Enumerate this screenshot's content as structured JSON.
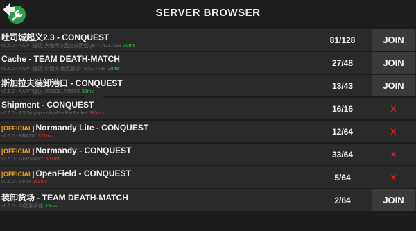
{
  "header": {
    "title": "SERVER BROWSER"
  },
  "colors": {
    "background": "#1c1c1c",
    "row": "#2a2a2a",
    "join_bg": "#3a3a3a",
    "official": "#f0a01e",
    "ping_good": "#3ec24a",
    "ping_bad": "#e02a2a",
    "full_x": "#e02020",
    "back_circle": "#2e9e4a"
  },
  "icons": {
    "back": "back-arrow-wrench-icon"
  },
  "servers": [
    {
      "official": "",
      "name": "吐司城起义2.3 - CONQUEST",
      "sub": "v0.5.0 - AAA中国区-大地阿尔瓦全关闭组QB-714217299",
      "ping": "30ms",
      "ping_status": "good",
      "players": "81/128",
      "action": "JOIN",
      "full": false
    },
    {
      "official": "",
      "name": "Cache - TEAM DEATH-MATCH",
      "sub": "v0.5.0 - AAA中国区-小图洗 地区服群-714217299",
      "ping": "20ms",
      "ping_status": "good",
      "players": "27/48",
      "action": "JOIN",
      "full": false
    },
    {
      "official": "",
      "name": "斯加拉夫装卸港口 - CONQUEST",
      "sub": "v0.5.0 - AAA中国区-2021081445553",
      "ping": "32ms",
      "ping_status": "good",
      "players": "13/43",
      "action": "JOIN",
      "full": false
    },
    {
      "official": "",
      "name": "Shipment - CONQUEST",
      "sub": "v0.5.0 - AS|Singapore|byWealthyBucket",
      "ping": "385ms",
      "ping_status": "bad",
      "players": "16/16",
      "action": "X",
      "full": true
    },
    {
      "official": "[OFFICIAL]",
      "name": "Normandy Lite - CONQUEST",
      "sub": "v0.5.0 - BRAZIL",
      "ping": "371ms",
      "ping_status": "bad",
      "players": "12/64",
      "action": "X",
      "full": true
    },
    {
      "official": "[OFFICIAL]",
      "name": "Normandy - CONQUEST",
      "sub": "v0.5.0 - GERMANY",
      "ping": "381ms",
      "ping_status": "bad",
      "players": "33/64",
      "action": "X",
      "full": true
    },
    {
      "official": "[OFFICIAL]",
      "name": "OpenField - CONQUEST",
      "sub": "v0.5.0 - IRAN",
      "ping": "258ms",
      "ping_status": "bad",
      "players": "5/64",
      "action": "X",
      "full": true
    },
    {
      "official": "",
      "name": "装卸货场 - TEAM DEATH-MATCH",
      "sub": "v0.5.0 - 中国服务器",
      "ping": "13ms",
      "ping_status": "good",
      "players": "2/64",
      "action": "JOIN",
      "full": false
    }
  ]
}
